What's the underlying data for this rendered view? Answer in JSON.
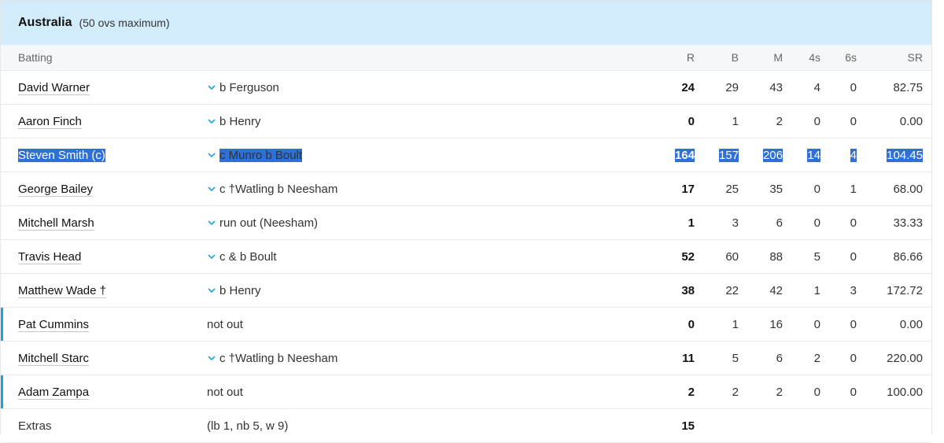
{
  "team": {
    "name": "Australia",
    "note": "(50 ovs maximum)"
  },
  "columns": {
    "batting": "Batting",
    "r": "R",
    "b": "B",
    "m": "M",
    "fours": "4s",
    "sixes": "6s",
    "sr": "SR"
  },
  "rows": [
    {
      "name": "David Warner",
      "dismissal": "b Ferguson",
      "r": "24",
      "b": "29",
      "m": "43",
      "fours": "4",
      "sixes": "0",
      "sr": "82.75"
    },
    {
      "name": "Aaron Finch",
      "dismissal": "b Henry",
      "r": "0",
      "b": "1",
      "m": "2",
      "fours": "0",
      "sixes": "0",
      "sr": "0.00"
    },
    {
      "name": "Steven Smith (c)",
      "dismissal": "c Munro b Boult",
      "r": "164",
      "b": "157",
      "m": "206",
      "fours": "14",
      "sixes": "4",
      "sr": "104.45"
    },
    {
      "name": "George Bailey",
      "dismissal": "c †Watling b Neesham",
      "r": "17",
      "b": "25",
      "m": "35",
      "fours": "0",
      "sixes": "1",
      "sr": "68.00"
    },
    {
      "name": "Mitchell Marsh",
      "dismissal": "run out (Neesham)",
      "r": "1",
      "b": "3",
      "m": "6",
      "fours": "0",
      "sixes": "0",
      "sr": "33.33"
    },
    {
      "name": "Travis Head",
      "dismissal": "c & b Boult",
      "r": "52",
      "b": "60",
      "m": "88",
      "fours": "5",
      "sixes": "0",
      "sr": "86.66"
    },
    {
      "name": "Matthew Wade †",
      "dismissal": "b Henry",
      "r": "38",
      "b": "22",
      "m": "42",
      "fours": "1",
      "sixes": "3",
      "sr": "172.72"
    },
    {
      "name": "Pat Cummins",
      "dismissal": "not out",
      "r": "0",
      "b": "1",
      "m": "16",
      "fours": "0",
      "sixes": "0",
      "sr": "0.00"
    },
    {
      "name": "Mitchell Starc",
      "dismissal": "c †Watling b Neesham",
      "r": "11",
      "b": "5",
      "m": "6",
      "fours": "2",
      "sixes": "0",
      "sr": "220.00"
    },
    {
      "name": "Adam Zampa",
      "dismissal": "not out",
      "r": "2",
      "b": "2",
      "m": "2",
      "fours": "0",
      "sixes": "0",
      "sr": "100.00"
    }
  ],
  "extras": {
    "label": "Extras",
    "detail": "(lb 1, nb 5, w 9)",
    "total": "15"
  },
  "colors": {
    "header_bg": "#d3ecfb",
    "accent": "#1aa5d8",
    "selection": "#2f6fd6"
  },
  "icons": {
    "expand": "chevron-down-icon"
  }
}
